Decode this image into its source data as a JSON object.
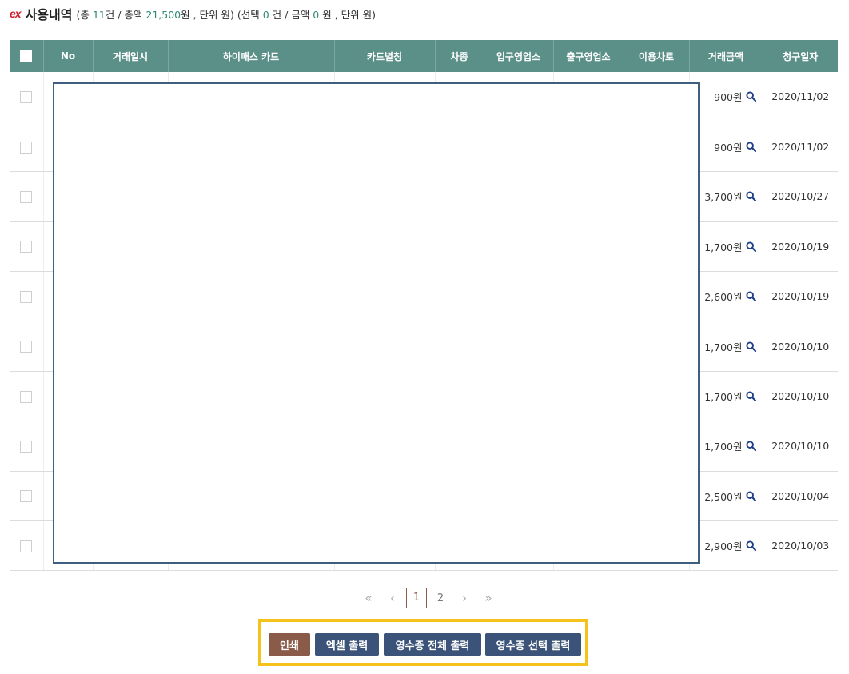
{
  "header": {
    "logo": "ex",
    "title": "사용내역",
    "summary_prefix": "(총 ",
    "total_count": "11",
    "summary_mid1": "건 / 총액 ",
    "total_amount": "21,500",
    "summary_mid2": "원 , 단위 원) (선택 ",
    "selected_count": "0",
    "summary_mid3": " 건 / 금액 ",
    "selected_amount": "0",
    "summary_suffix": " 원 , 단위 원)"
  },
  "table": {
    "columns": [
      "No",
      "거래일시",
      "하이패스 카드",
      "카드별칭",
      "차종",
      "입구영업소",
      "출구영업소",
      "이용차로",
      "거래금액",
      "청구일자"
    ],
    "rows": [
      {
        "amount": "900원",
        "billing_date": "2020/11/02"
      },
      {
        "amount": "900원",
        "billing_date": "2020/11/02"
      },
      {
        "amount": "3,700원",
        "billing_date": "2020/10/27"
      },
      {
        "amount": "1,700원",
        "billing_date": "2020/10/19"
      },
      {
        "amount": "2,600원",
        "billing_date": "2020/10/19"
      },
      {
        "amount": "1,700원",
        "billing_date": "2020/10/10"
      },
      {
        "amount": "1,700원",
        "billing_date": "2020/10/10"
      },
      {
        "amount": "1,700원",
        "billing_date": "2020/10/10"
      },
      {
        "amount": "2,500원",
        "billing_date": "2020/10/04"
      },
      {
        "amount": "2,900원",
        "billing_date": "2020/10/03"
      }
    ]
  },
  "pagination": {
    "first": "«",
    "prev": "‹",
    "pages": [
      "1",
      "2"
    ],
    "current": "1",
    "next": "›",
    "last": "»"
  },
  "buttons": {
    "print": "인쇄",
    "excel": "엑셀 출력",
    "receipt_all": "영수증 전체 출력",
    "receipt_selected": "영수증 선택 출력"
  },
  "colors": {
    "header_bg": "#5b9089",
    "accent_number": "#2f8a76",
    "print_button": "#8a5b48",
    "action_button": "#3b5378",
    "highlight_border": "#f5c21b",
    "search_icon": "#1f3f86"
  },
  "icons": {
    "amount_detail": "magnifier-icon"
  }
}
